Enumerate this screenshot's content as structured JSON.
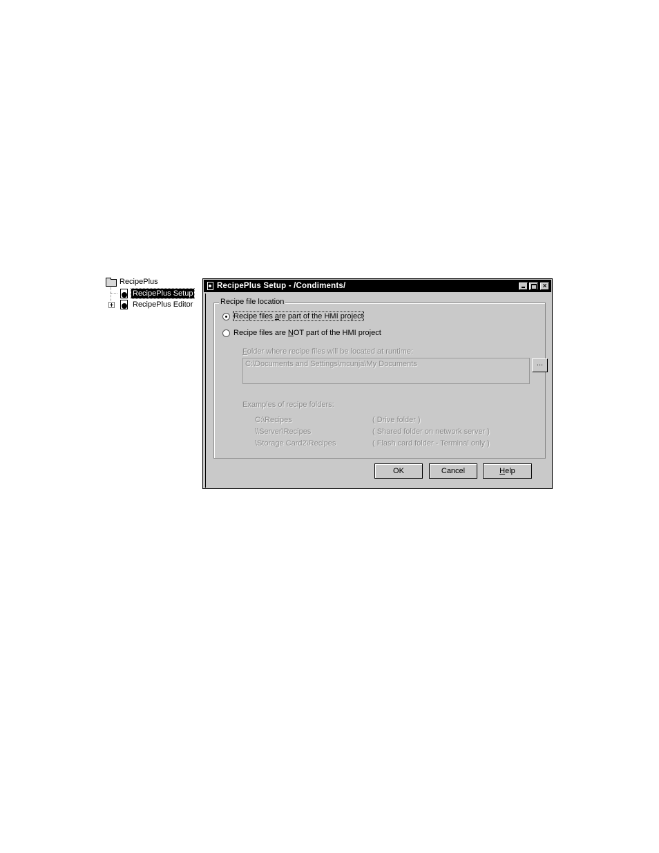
{
  "tree": {
    "root_label": "RecipePlus",
    "children": [
      {
        "label": "RecipePlus Setup",
        "selected": true,
        "icon": "recipe-setup-icon"
      },
      {
        "label": "RecipePlus Editor",
        "selected": false,
        "icon": "recipe-editor-icon"
      }
    ]
  },
  "dialog": {
    "title": "RecipePlus Setup - /Condiments/",
    "group_label": "Recipe file location",
    "radio_part": {
      "pre": "Recipe files ",
      "ul": "a",
      "post": "re part of the HMI project",
      "checked": true
    },
    "radio_not_part": {
      "pre": "Recipe files are ",
      "ul": "N",
      "post": "OT part of the HMI project",
      "checked": false
    },
    "folder_label": {
      "ul": "F",
      "post": "older where recipe files will be located at runtime:"
    },
    "folder_value": "C:\\Documents and Settings\\mcunja\\My Documents",
    "browse_label": "...",
    "examples_title": "Examples of recipe folders:",
    "examples": [
      {
        "path": "C:\\Recipes",
        "desc": "( Drive folder )"
      },
      {
        "path": "\\\\Server\\Recipes",
        "desc": "( Shared folder on network server )"
      },
      {
        "path": "\\Storage Card2\\Recipes",
        "desc": "( Flash card folder - Terminal only )"
      }
    ],
    "ok_label": "OK",
    "cancel_label": "Cancel",
    "help_label": {
      "ul": "H",
      "post": "elp"
    }
  }
}
